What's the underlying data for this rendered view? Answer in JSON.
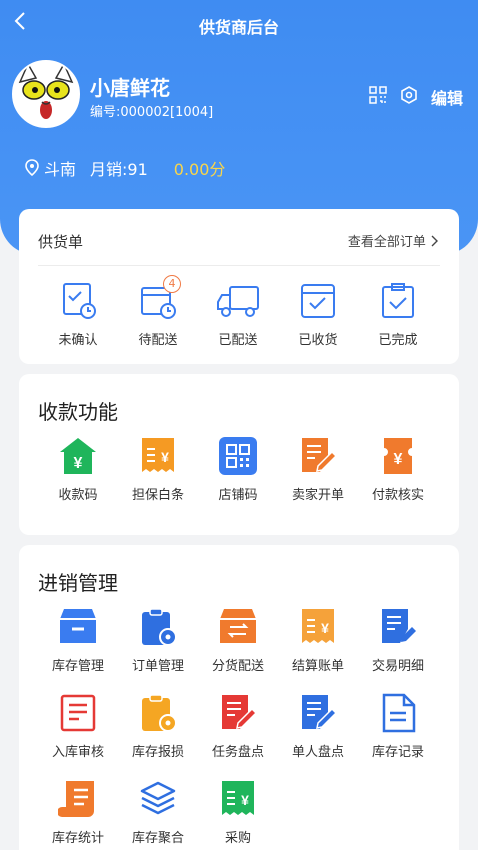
{
  "nav": {
    "back_icon": "chevron-left-icon",
    "title": "供货商后台"
  },
  "profile": {
    "store_name": "小唐鲜花",
    "store_id": "编号:000002[1004]",
    "icons": [
      "qrcode-icon",
      "settings-icon"
    ],
    "edit_label": "编辑",
    "location": "斗南",
    "monthly_sales": "月销:91",
    "score": "0.00分"
  },
  "supply_orders": {
    "title": "供货单",
    "view_all": "查看全部订单",
    "items": [
      {
        "label": "未确认",
        "icon": "clock-checklist-icon"
      },
      {
        "label": "待配送",
        "icon": "package-clock-icon",
        "badge": "4"
      },
      {
        "label": "已配送",
        "icon": "truck-icon"
      },
      {
        "label": "已收货",
        "icon": "inbox-check-icon"
      },
      {
        "label": "已完成",
        "icon": "clipboard-check-icon"
      }
    ]
  },
  "payment": {
    "title": "收款功能",
    "items": [
      {
        "label": "收款码",
        "icon": "house-yuan-icon",
        "color": "#1fb55b"
      },
      {
        "label": "担保白条",
        "icon": "receipt-yuan-icon",
        "color": "#f59a23"
      },
      {
        "label": "店铺码",
        "icon": "qrcode-icon",
        "color": "#3a7cf0"
      },
      {
        "label": "卖家开单",
        "icon": "edit-doc-icon",
        "color": "#f07a2d"
      },
      {
        "label": "付款核实",
        "icon": "ticket-yuan-icon",
        "color": "#f07a2d"
      }
    ]
  },
  "inventory": {
    "title": "进销管理",
    "items": [
      {
        "label": "库存管理",
        "icon": "box-icon",
        "color": "#3a7cf0"
      },
      {
        "label": "订单管理",
        "icon": "clipboard-gear-icon",
        "color": "#2f6fe0"
      },
      {
        "label": "分货配送",
        "icon": "box-exchange-icon",
        "color": "#f07a2d"
      },
      {
        "label": "结算账单",
        "icon": "receipt-yuan-icon",
        "color": "#f5a23a"
      },
      {
        "label": "交易明细",
        "icon": "doc-pen-icon",
        "color": "#2f6fe0"
      },
      {
        "label": "入库审核",
        "icon": "doc-list-icon",
        "color": "#e53935"
      },
      {
        "label": "库存报损",
        "icon": "clipboard-gear-icon",
        "color": "#f5a623"
      },
      {
        "label": "任务盘点",
        "icon": "doc-pen-icon",
        "color": "#e53935"
      },
      {
        "label": "单人盘点",
        "icon": "doc-pen-icon",
        "color": "#2f6fe0"
      },
      {
        "label": "库存记录",
        "icon": "doc-outline-icon",
        "color": "#2f6fe0"
      },
      {
        "label": "库存统计",
        "icon": "scroll-list-icon",
        "color": "#f07a2d"
      },
      {
        "label": "库存聚合",
        "icon": "layers-icon",
        "color": "#2f6fe0"
      },
      {
        "label": "采购",
        "icon": "receipt-yuan-icon",
        "color": "#1fb55b"
      }
    ]
  }
}
